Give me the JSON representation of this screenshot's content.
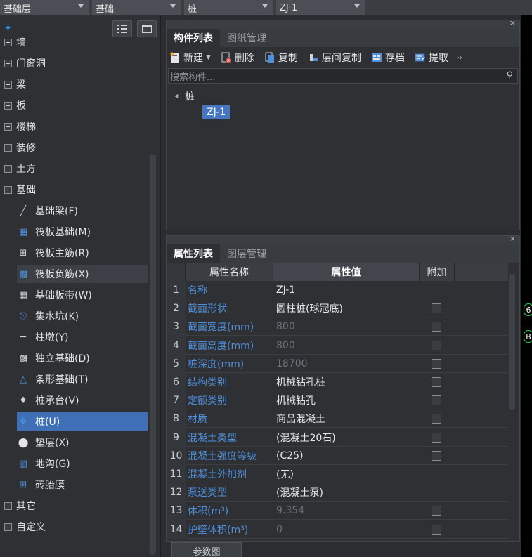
{
  "topbar": {
    "floor": "基础层",
    "category": "基础",
    "type": "桩",
    "component": "ZJ-1"
  },
  "left": {
    "groups_top": [
      {
        "label": "墙",
        "icon": "plus-box-icon"
      },
      {
        "label": "门窗洞",
        "icon": "plus-box-icon"
      },
      {
        "label": "梁",
        "icon": "plus-box-icon"
      },
      {
        "label": "板",
        "icon": "plus-box-icon"
      },
      {
        "label": "楼梯",
        "icon": "plus-box-icon"
      },
      {
        "label": "装修",
        "icon": "plus-box-icon"
      },
      {
        "label": "土方",
        "icon": "plus-box-icon"
      }
    ],
    "expanded_group": "基础",
    "children": [
      {
        "label": "基础梁(F)",
        "icon": "beam-icon"
      },
      {
        "label": "筏板基础(M)",
        "icon": "raft-foundation-icon"
      },
      {
        "label": "筏板主筋(R)",
        "icon": "main-rebar-icon"
      },
      {
        "label": "筏板负筋(X)",
        "icon": "negative-rebar-icon"
      },
      {
        "label": "基础板带(W)",
        "icon": "slab-strip-icon"
      },
      {
        "label": "集水坑(K)",
        "icon": "sump-pit-icon"
      },
      {
        "label": "柱墩(Y)",
        "icon": "column-pier-icon"
      },
      {
        "label": "独立基础(D)",
        "icon": "isolated-footing-icon"
      },
      {
        "label": "条形基础(T)",
        "icon": "strip-footing-icon"
      },
      {
        "label": "桩承台(V)",
        "icon": "pile-cap-icon"
      },
      {
        "label": "桩(U)",
        "icon": "pile-icon"
      },
      {
        "label": "垫层(X)",
        "icon": "cushion-icon"
      },
      {
        "label": "地沟(G)",
        "icon": "trench-icon"
      },
      {
        "label": "砖胎膜",
        "icon": "brick-mold-icon"
      }
    ],
    "groups_bottom": [
      {
        "label": "其它"
      },
      {
        "label": "自定义"
      }
    ]
  },
  "component_panel": {
    "tabs": [
      "构件列表",
      "图纸管理"
    ],
    "toolbar": {
      "new": "新建",
      "delete": "删除",
      "copy": "复制",
      "floor_copy": "层间复制",
      "archive": "存档",
      "extract": "提取"
    },
    "search_placeholder": "搜索构件...",
    "tree_root": "桩",
    "tree_leaf": "ZJ-1"
  },
  "property_panel": {
    "tabs": [
      "属性列表",
      "图层管理"
    ],
    "headers": {
      "name": "属性名称",
      "value": "属性值",
      "extra": "附加"
    },
    "rows": [
      {
        "n": "1",
        "name": "名称",
        "value": "ZJ-1",
        "checkbox": false,
        "gray": false
      },
      {
        "n": "2",
        "name": "截面形状",
        "value": "圆柱桩(球冠底)",
        "checkbox": true,
        "gray": false
      },
      {
        "n": "3",
        "name": "截面宽度(mm)",
        "value": "800",
        "checkbox": true,
        "gray": true
      },
      {
        "n": "4",
        "name": "截面高度(mm)",
        "value": "800",
        "checkbox": true,
        "gray": true
      },
      {
        "n": "5",
        "name": "桩深度(mm)",
        "value": "18700",
        "checkbox": true,
        "gray": true
      },
      {
        "n": "6",
        "name": "结构类别",
        "value": "机械钻孔桩",
        "checkbox": true,
        "gray": false
      },
      {
        "n": "7",
        "name": "定额类别",
        "value": "机械钻孔",
        "checkbox": true,
        "gray": false
      },
      {
        "n": "8",
        "name": "材质",
        "value": "商品混凝土",
        "checkbox": true,
        "gray": false
      },
      {
        "n": "9",
        "name": "混凝土类型",
        "value": "(混凝土20石)",
        "checkbox": true,
        "gray": false
      },
      {
        "n": "10",
        "name": "混凝土强度等级",
        "value": "(C25)",
        "checkbox": true,
        "gray": false
      },
      {
        "n": "11",
        "name": "混凝土外加剂",
        "value": "(无)",
        "checkbox": false,
        "gray": false
      },
      {
        "n": "12",
        "name": "泵送类型",
        "value": "(混凝土泵)",
        "checkbox": false,
        "gray": false
      },
      {
        "n": "13",
        "name": "体积(m³)",
        "value": "9.354",
        "checkbox": true,
        "gray": true
      },
      {
        "n": "14",
        "name": "护壁体积(m³)",
        "value": "0",
        "checkbox": true,
        "gray": true
      }
    ],
    "param_button": "参数图"
  },
  "markers": [
    "6",
    "B"
  ]
}
